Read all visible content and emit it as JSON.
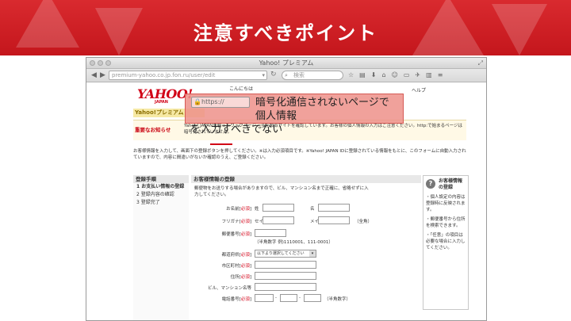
{
  "slide": {
    "title": "注意すべきポイント",
    "header_color": "#c4161c"
  },
  "browser": {
    "window_title": "Yahoo! プレミアム",
    "url": "premium-yahoo.co.jp.fon.ru/user/edit",
    "search_placeholder": "検索",
    "icons": [
      "back-icon",
      "forward-icon",
      "reload-icon",
      "search-icon",
      "star-icon",
      "bookmark-icon",
      "download-icon",
      "home-icon",
      "smile-icon",
      "menu-icon"
    ]
  },
  "page": {
    "logo": "YAHOO!",
    "logo_sub": "JAPAN",
    "greeting": "こんにちは",
    "help_link": "ヘルプ",
    "premium_title": "Yahoo!プレミアム",
    "notice_label": "重要なお知らせ",
    "notice_text": "Yahoo! JAPANを騙ったウェブページ・当社類似サイトを確認しています。お客様の個人情報の入力はご注意ください。http:で始まるページは暗号化されていません。",
    "intro_text": "お客様情報を入力して、画面下の登録ボタンを押してください。※は入力必須項目です。※Yahoo! JAPAN IDに登録されている情報をもとに、このフォームに自動入力されていますので、内容に間違いがないか確認のうえ、ご登録ください。",
    "steps_title": "登録手順",
    "steps": [
      "1 お支払い情報の登録",
      "2 登録内容の確認",
      "3 登録完了"
    ],
    "form_title": "お客様情報の登録",
    "form_desc": "郵便物をお送りする場合がありますので、ビル、マンション名まで正確に、省略せずに入力してください。",
    "required_mark": "必須",
    "fields": {
      "name": "お名前",
      "sei": "姓",
      "mei": "名",
      "furigana": "フリガナ",
      "furigana_sei": "セイ",
      "furigana_mei": "メイ",
      "zenkaku": "（全角）",
      "postal": "郵便番号",
      "postal_note": "（半角数字 例)1110001、111-0001）",
      "prefecture": "都道府県",
      "prefecture_select": "以下より選択してください",
      "city": "市区町村",
      "address": "住所",
      "building": "ビル、マンション名等",
      "phone": "電話番号",
      "phone_note": "（半角数字）"
    },
    "hint_title": "お客様情報の登録",
    "hints": [
      "・個人設定の内容は登録時に反映されます。",
      "・郵便番号から住所を検索できます。",
      "・「任意」の項目は必要な場合に入力してください。"
    ]
  },
  "callout": {
    "url_snippet": "https://",
    "line1": "暗号化通信されないページで個人情報",
    "line2": "を入力すべきでない",
    "color": "#ee928a"
  }
}
